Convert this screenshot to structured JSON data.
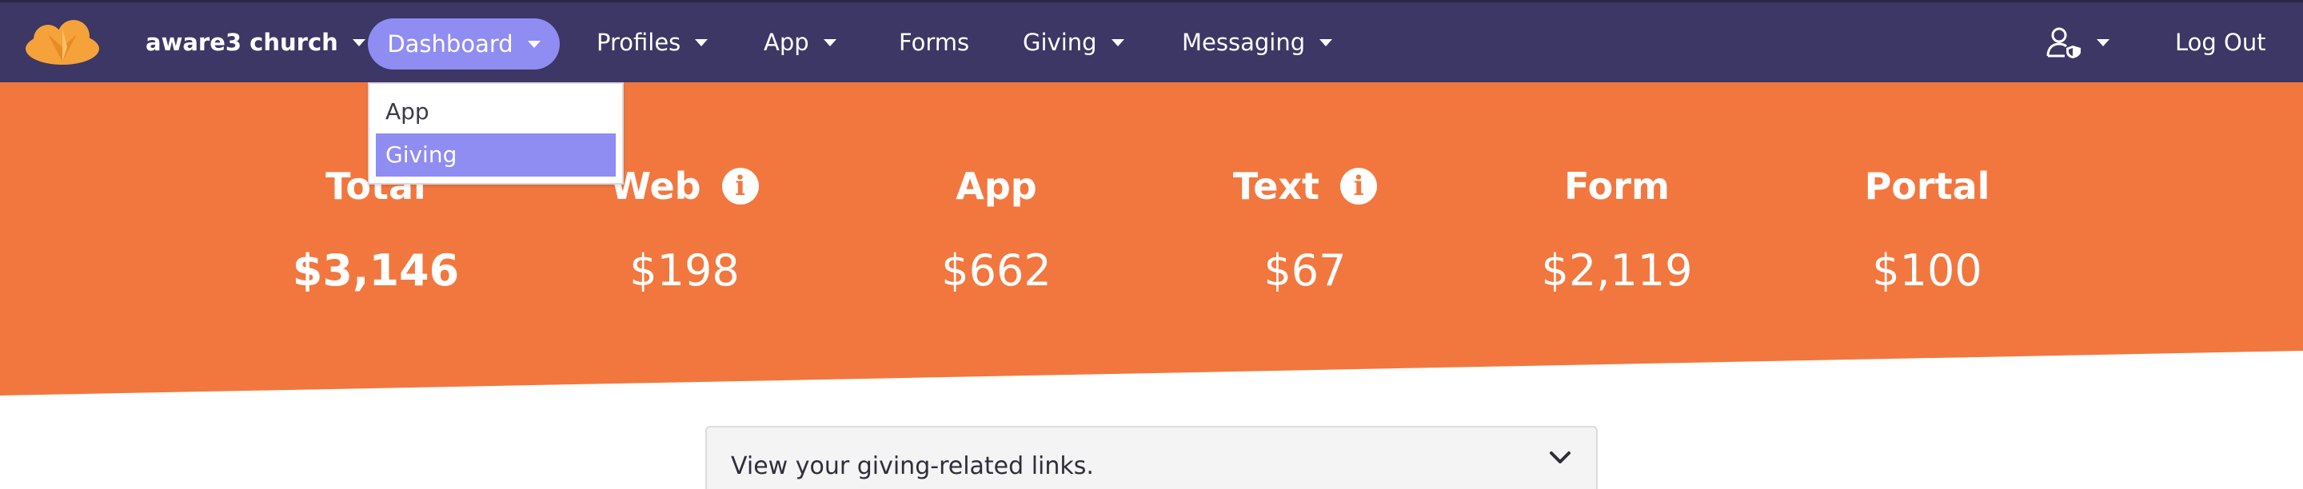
{
  "nav": {
    "brand": "aware3 church",
    "items": {
      "dashboard": "Dashboard",
      "profiles": "Profiles",
      "app": "App",
      "forms": "Forms",
      "giving": "Giving",
      "messaging": "Messaging"
    },
    "logout": "Log Out"
  },
  "dashboard_menu": {
    "items": [
      "App",
      "Giving"
    ],
    "active": "Giving"
  },
  "stats": [
    {
      "label": "Total",
      "value": "$3,146",
      "info": false
    },
    {
      "label": "Web",
      "value": "$198",
      "info": true
    },
    {
      "label": "App",
      "value": "$662",
      "info": false
    },
    {
      "label": "Text",
      "value": "$67",
      "info": true
    },
    {
      "label": "Form",
      "value": "$2,119",
      "info": false
    },
    {
      "label": "Portal",
      "value": "$100",
      "info": false
    }
  ],
  "accordion": {
    "text": "View your giving-related links."
  },
  "colors": {
    "navbar": "#3c3764",
    "accent": "#8f8cf2",
    "hero": "#f2773e",
    "logo": "#f5a23a"
  },
  "icons": {
    "logo": "aware3-logo",
    "user": "user-shield-icon",
    "info": "info-icon",
    "chevron": "chevron-down-icon"
  }
}
